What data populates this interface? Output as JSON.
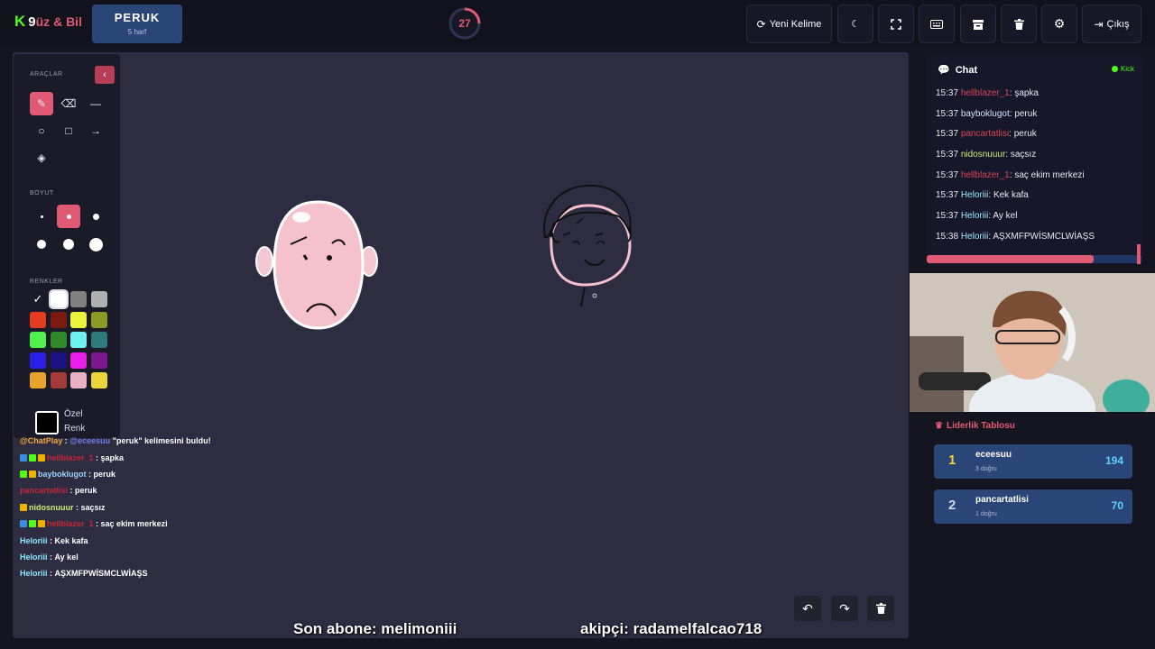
{
  "app": {
    "logo_k": "K",
    "logo_num": "9",
    "logo_text": "üz & Bil"
  },
  "word": {
    "text": "PERUK",
    "hint": "5 harf"
  },
  "timer": {
    "value": "27",
    "fraction_remaining": 0.25
  },
  "toolbar": {
    "new_word": "Yeni Kelime",
    "exit": "Çıkış"
  },
  "tools": {
    "section_tools": "ARAÇLAR",
    "section_size": "BOYUT",
    "section_colors": "RENKLER",
    "custom_color_label_1": "Özel",
    "custom_color_label_2": "Renk",
    "colors": [
      "#000000",
      "#ffffff",
      "#808080",
      "#b0b0b0",
      "#e53b1f",
      "#7a1b12",
      "#eaf23c",
      "#8a9a22",
      "#4ff24d",
      "#2f8a2a",
      "#6ff1ef",
      "#2f7a7c",
      "#2b1fe8",
      "#1b1282",
      "#e71fe8",
      "#7d168f",
      "#e8a42a",
      "#a33a38",
      "#eab2c4",
      "#e9d53a"
    ]
  },
  "overlay_chat": [
    {
      "user": "@ChatPlay",
      "user_color": "#f0a63c",
      "sep": " : ",
      "text_pre": "@eceesuu",
      "text": " \"peruk\" kelimesini buldu!",
      "mention_color": "#6f7fe8",
      "badges": []
    },
    {
      "user": "hellblazer_1",
      "user_color": "#c0273b",
      "sep": " : ",
      "text": "şapka",
      "badges": [
        "#3a8de0",
        "#53fc18",
        "#f0b000"
      ]
    },
    {
      "user": "bayboklugot",
      "user_color": "#9fd0ff",
      "sep": " : ",
      "text": "peruk",
      "badges": [
        "#53fc18",
        "#f0b000"
      ]
    },
    {
      "user": "pancartatlisi",
      "user_color": "#c0273b",
      "sep": " : ",
      "text": "peruk",
      "badges": []
    },
    {
      "user": "nidosnuuur",
      "user_color": "#c8f07c",
      "sep": " : ",
      "text": "saçsız",
      "badges": [
        "#f0b000"
      ]
    },
    {
      "user": "hellblazer_1",
      "user_color": "#c0273b",
      "sep": " : ",
      "text": "saç ekim merkezi",
      "badges": [
        "#3a8de0",
        "#53fc18",
        "#f0b000"
      ]
    },
    {
      "user": "Heloriii",
      "user_color": "#8fe8ff",
      "sep": " : ",
      "text": "Kek kafa",
      "badges": []
    },
    {
      "user": "Heloriii",
      "user_color": "#8fe8ff",
      "sep": " : ",
      "text": "Ay kel",
      "badges": []
    },
    {
      "user": "Heloriii",
      "user_color": "#8fe8ff",
      "sep": " : ",
      "text": "AŞXMFPWİSMCLWİAŞS",
      "badges": []
    }
  ],
  "bottom": {
    "left": "Son abone: melimoniii",
    "right": "akipçi: radamelfalcao718"
  },
  "chat": {
    "title": "Chat",
    "platform": "Kick",
    "messages": [
      {
        "time": "15:37",
        "user": "hellblazer_1",
        "color": "#d9455c",
        "text": "şapka"
      },
      {
        "time": "15:37",
        "user": "bayboklugot",
        "color": "#cfe6ff",
        "text": "peruk"
      },
      {
        "time": "15:37",
        "user": "pancartatlisi",
        "color": "#d9455c",
        "text": "peruk"
      },
      {
        "time": "15:37",
        "user": "nidosnuuur",
        "color": "#c8f07c",
        "text": "saçsız"
      },
      {
        "time": "15:37",
        "user": "hellblazer_1",
        "color": "#d9455c",
        "text": "saç ekim merkezi"
      },
      {
        "time": "15:37",
        "user": "Heloriii",
        "color": "#9fe8ff",
        "text": "Kek kafa"
      },
      {
        "time": "15:37",
        "user": "Heloriii",
        "color": "#9fe8ff",
        "text": "Ay kel"
      },
      {
        "time": "15:38",
        "user": "Heloriii",
        "color": "#9fe8ff",
        "text": "AŞXMFPWİSMCLWİAŞS"
      }
    ]
  },
  "leaderboard": {
    "title": "Liderlik Tablosu",
    "rows": [
      {
        "rank": "1",
        "name": "eceesuu",
        "sub": "3 doğru",
        "score": "194",
        "rank_color": "#f5d033"
      },
      {
        "rank": "2",
        "name": "pancartatlisi",
        "sub": "1 doğru",
        "score": "70",
        "rank_color": "#d0d6e6"
      }
    ]
  }
}
